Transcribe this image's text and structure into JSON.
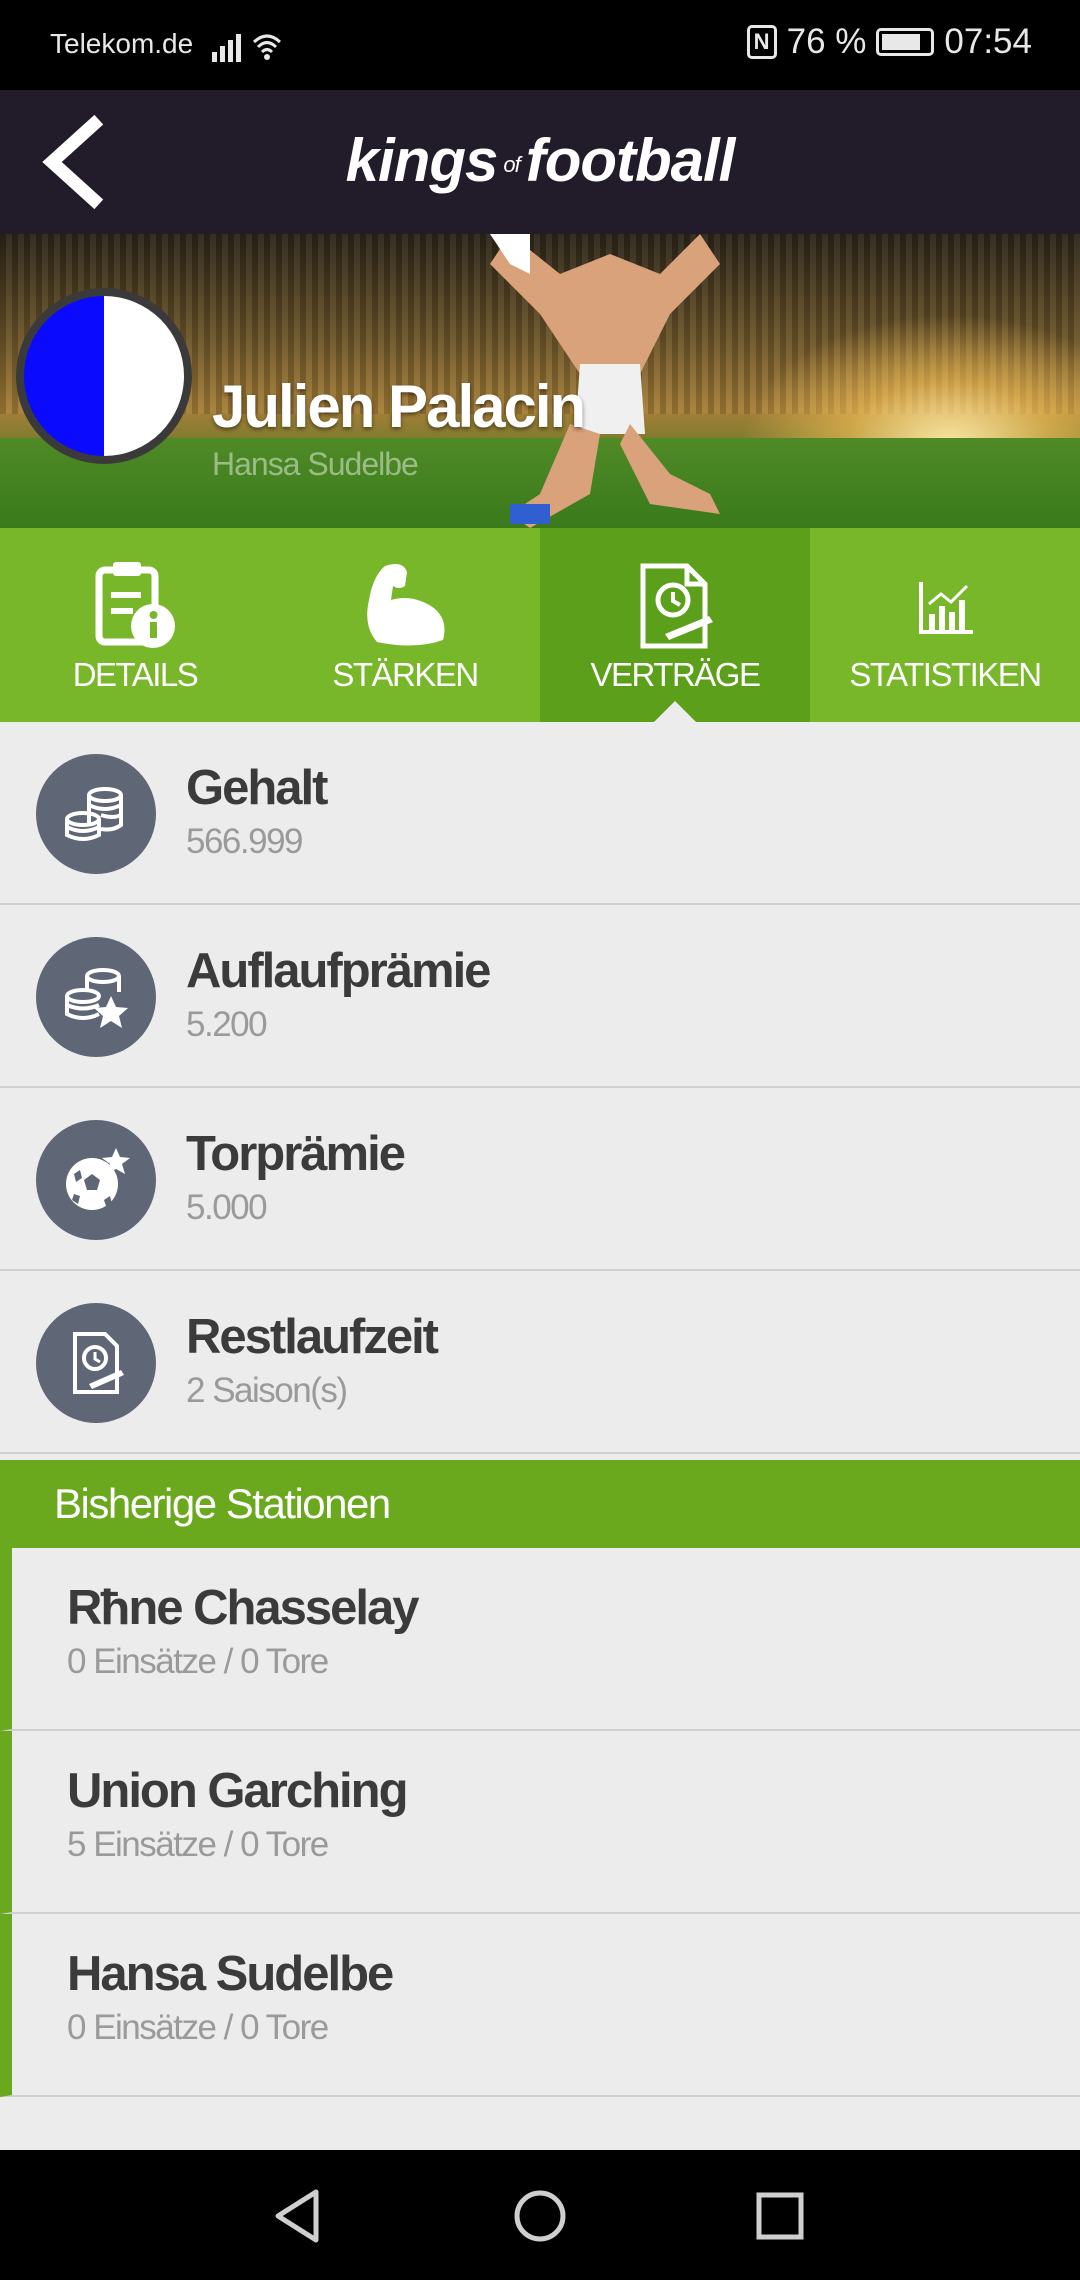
{
  "status_bar": {
    "carrier": "Telekom.de",
    "battery": "76 %",
    "time": "07:54",
    "icons": [
      "signal-icon",
      "wifi-icon",
      "nfc-icon",
      "battery-icon"
    ]
  },
  "header": {
    "logo_part1": "kings",
    "logo_part2": "of",
    "logo_part3": "football",
    "back_icon": "back-arrow-icon"
  },
  "player": {
    "name": "Julien Palacin",
    "club": "Hansa Sudelbe",
    "badge_colors": [
      "#0a0aff",
      "#ffffff"
    ]
  },
  "tabs": [
    {
      "label": "DETAILS",
      "icon": "details-icon",
      "active": false
    },
    {
      "label": "STÄRKEN",
      "icon": "strength-icon",
      "active": false
    },
    {
      "label": "VERTRÄGE",
      "icon": "contract-icon",
      "active": true
    },
    {
      "label": "STATISTIKEN",
      "icon": "statistics-icon",
      "active": false
    }
  ],
  "contract": [
    {
      "title": "Gehalt",
      "value": "566.999",
      "icon": "coins-icon"
    },
    {
      "title": "Auflaufprämie",
      "value": "5.200",
      "icon": "coins-star-icon"
    },
    {
      "title": "Torprämie",
      "value": "5.000",
      "icon": "ball-star-icon"
    },
    {
      "title": "Restlaufzeit",
      "value": "2 Saison(s)",
      "icon": "contract-clock-icon"
    }
  ],
  "stations_header": "Bisherige Stationen",
  "stations": [
    {
      "club": "Rħne Chasselay",
      "stats": "0 Einsätze / 0 Tore"
    },
    {
      "club": "Union Garching",
      "stats": "5 Einsätze / 0 Tore"
    },
    {
      "club": "Hansa Sudelbe",
      "stats": "0 Einsätze / 0 Tore"
    }
  ],
  "colors": {
    "header_bg": "#221b29",
    "tab_green": "#78b72a",
    "tab_active": "#5c9f1b",
    "section_green": "#6aa81e",
    "icon_circle": "#5f6676"
  }
}
